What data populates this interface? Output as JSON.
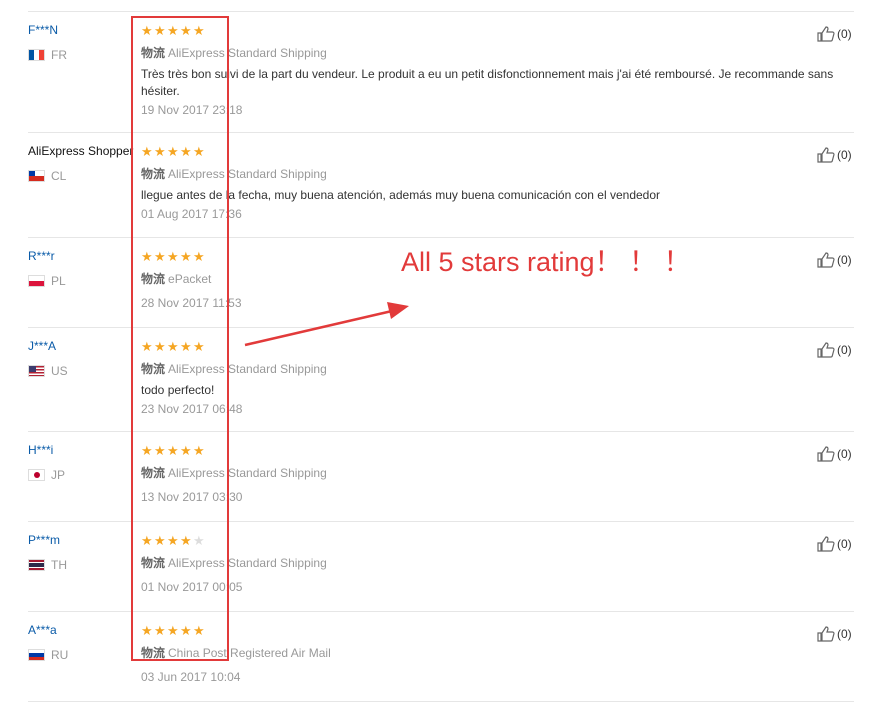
{
  "reviews": [
    {
      "name": "F***N",
      "country": "FR",
      "flag": "fr",
      "stars": 5,
      "shipping_label": "物流",
      "shipping": "AliExpress Standard Shipping",
      "text": "Très très bon suivi de la part du vendeur. Le produit a eu un petit disfonctionnement mais j'ai été remboursé. Je recommande sans hésiter.",
      "date": "19 Nov 2017 23:18",
      "helpful": "(0)"
    },
    {
      "name": "AliExpress Shopper",
      "country": "CL",
      "flag": "cl",
      "stars": 5,
      "shipping_label": "物流",
      "shipping": "AliExpress Standard Shipping",
      "text": "llegue antes de la fecha, muy buena atención, además muy buena comunicación con el vendedor",
      "date": "01 Aug 2017 17:36",
      "helpful": "(0)"
    },
    {
      "name": "R***r",
      "country": "PL",
      "flag": "pl",
      "stars": 5,
      "shipping_label": "物流",
      "shipping": "ePacket",
      "text": "",
      "date": "28 Nov 2017 11:53",
      "helpful": "(0)"
    },
    {
      "name": "J***A",
      "country": "US",
      "flag": "us",
      "stars": 5,
      "shipping_label": "物流",
      "shipping": "AliExpress Standard Shipping",
      "text": "todo perfecto!",
      "date": "23 Nov 2017 06:48",
      "helpful": "(0)"
    },
    {
      "name": "H***i",
      "country": "JP",
      "flag": "jp",
      "stars": 5,
      "shipping_label": "物流",
      "shipping": "AliExpress Standard Shipping",
      "text": "",
      "date": "13 Nov 2017 03:30",
      "helpful": "(0)"
    },
    {
      "name": "P***m",
      "country": "TH",
      "flag": "th",
      "stars": 4,
      "shipping_label": "物流",
      "shipping": "AliExpress Standard Shipping",
      "text": "",
      "date": "01 Nov 2017 00:05",
      "helpful": "(0)"
    },
    {
      "name": "A***a",
      "country": "RU",
      "flag": "ru",
      "stars": 5,
      "shipping_label": "物流",
      "shipping": "China Post Registered Air Mail",
      "text": "",
      "date": "03 Jun 2017 10:04",
      "helpful": "(0)"
    }
  ],
  "annotation": {
    "text": "All 5 stars rating！ ！ ！",
    "color": "#e23a3a"
  },
  "colors": {
    "star": "#f5a623",
    "star_empty": "#dddddd",
    "username": "#0a5ba8",
    "muted": "#999999"
  }
}
